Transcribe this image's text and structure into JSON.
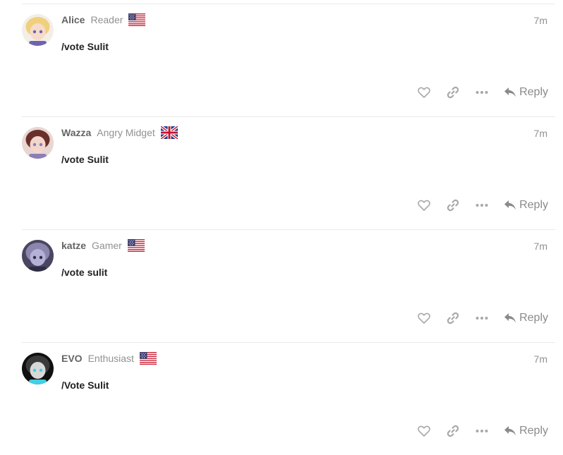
{
  "posts": [
    {
      "username": "Alice",
      "title": "Reader",
      "flag": "us",
      "time": "7m",
      "body": "/vote Sulit",
      "reply_label": "Reply",
      "avatar_colors": {
        "bg": "#f3eee6",
        "hair": "#f0cf7e",
        "face": "#f6dcc8",
        "accent": "#6e63b0"
      }
    },
    {
      "username": "Wazza",
      "title": "Angry Midget",
      "flag": "uk",
      "time": "7m",
      "body": "/vote Sulit",
      "reply_label": "Reply",
      "avatar_colors": {
        "bg": "#e7d6d2",
        "hair": "#6b2f2a",
        "face": "#f3d7cc",
        "accent": "#8b7fb5"
      }
    },
    {
      "username": "katze",
      "title": "Gamer",
      "flag": "us",
      "time": "7m",
      "body": "/vote sulit",
      "reply_label": "Reply",
      "avatar_colors": {
        "bg": "#4a4560",
        "hair": "#8a86ad",
        "face": "#b4b0d8",
        "accent": "#2f2c44"
      }
    },
    {
      "username": "EVO",
      "title": "Enthusiast",
      "flag": "us",
      "time": "7m",
      "body": "/Vote Sulit",
      "reply_label": "Reply",
      "avatar_colors": {
        "bg": "#101010",
        "hair": "#3a3a3a",
        "face": "#d8d8d8",
        "accent": "#3fd0e6"
      }
    }
  ],
  "icons": {
    "like": "heart-icon",
    "copy_link": "link-icon",
    "more": "ellipsis-icon",
    "reply": "reply-icon"
  },
  "colors": {
    "username": "#646464",
    "user_title": "#919191",
    "body_text": "#222222",
    "action_icon": "#a8a8a8",
    "divider": "#e9e9e9"
  }
}
